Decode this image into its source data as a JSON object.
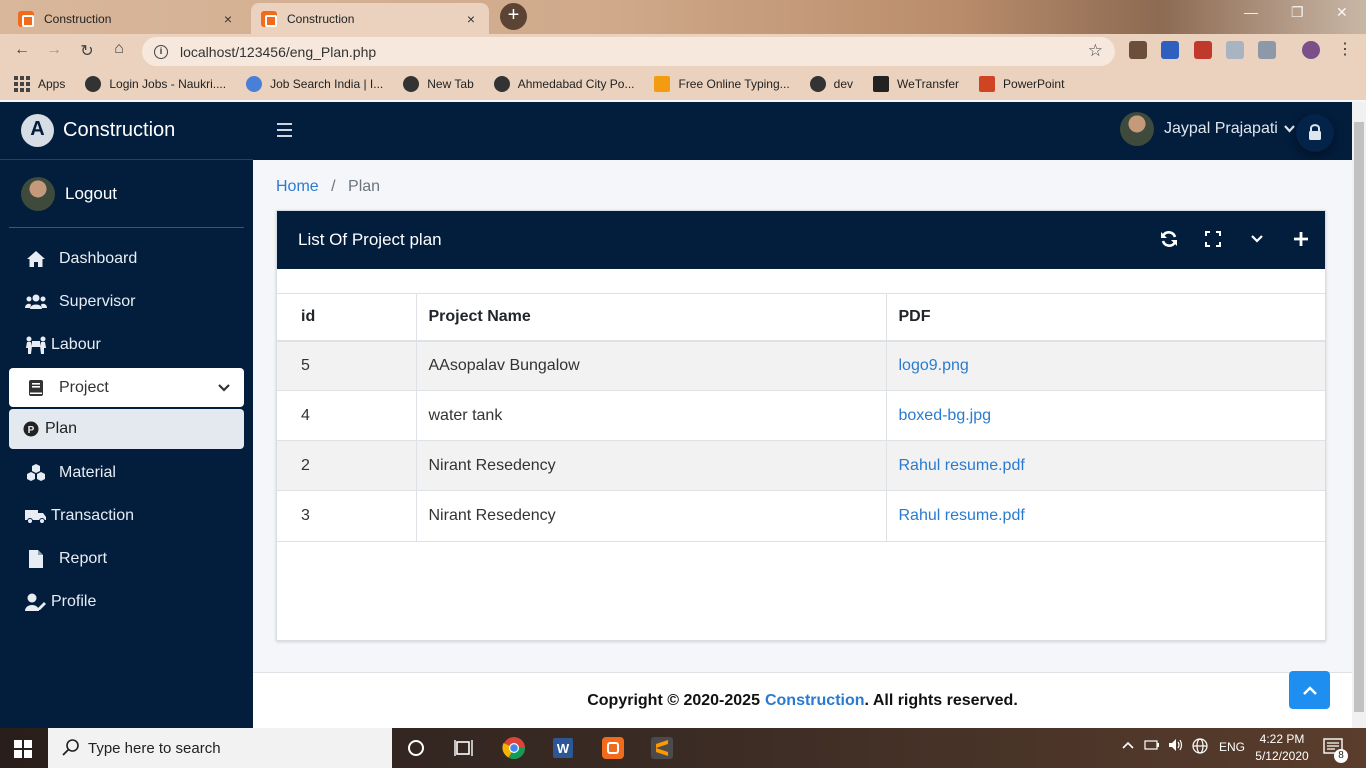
{
  "browser": {
    "tabs": [
      {
        "title": "Construction",
        "close": "×"
      },
      {
        "title": "Construction",
        "close": "×"
      }
    ],
    "new_tab": "+",
    "url": "localhost/123456/eng_Plan.php",
    "bookmarks": [
      {
        "label": "Apps"
      },
      {
        "label": "Login Jobs - Naukri...."
      },
      {
        "label": "Job Search India | I..."
      },
      {
        "label": "New Tab"
      },
      {
        "label": "Ahmedabad City Po..."
      },
      {
        "label": "Free Online Typing..."
      },
      {
        "label": "dev"
      },
      {
        "label": "WeTransfer"
      },
      {
        "label": "PowerPoint"
      }
    ]
  },
  "brand": {
    "name": "Construction"
  },
  "sidebar": {
    "logout": "Logout",
    "items": [
      {
        "label": "Dashboard",
        "icon": "home-icon"
      },
      {
        "label": "Supervisor",
        "icon": "users-icon"
      },
      {
        "label": "Labour",
        "icon": "people-carry-icon"
      },
      {
        "label": "Project",
        "icon": "book-icon"
      },
      {
        "label": "Plan",
        "icon": "plan-p-icon"
      },
      {
        "label": "Material",
        "icon": "cubes-icon"
      },
      {
        "label": "Transaction",
        "icon": "truck-icon"
      },
      {
        "label": "Report",
        "icon": "file-icon"
      },
      {
        "label": "Profile",
        "icon": "user-edit-icon"
      }
    ]
  },
  "topnav": {
    "user_name": "Jaypal Prajapati"
  },
  "breadcrumb": {
    "home": "Home",
    "separator": "/",
    "current": "Plan"
  },
  "card": {
    "title": "List Of Project plan",
    "columns": [
      "id",
      "Project Name",
      "PDF"
    ],
    "rows": [
      {
        "id": "5",
        "project_name": "AAsopalav Bungalow",
        "pdf": "logo9.png"
      },
      {
        "id": "4",
        "project_name": "water tank",
        "pdf": "boxed-bg.jpg"
      },
      {
        "id": "2",
        "project_name": "Nirant Resedency",
        "pdf": "Rahul resume.pdf"
      },
      {
        "id": "3",
        "project_name": "Nirant Resedency",
        "pdf": "Rahul resume.pdf"
      }
    ]
  },
  "footer": {
    "prefix": "Copyright © 2020-2025",
    "brand": "Construction",
    "suffix": ". All rights reserved."
  },
  "taskbar": {
    "search_placeholder": "Type here to search",
    "language": "ENG",
    "time": "4:22 PM",
    "date": "5/12/2020",
    "notifications": "8"
  },
  "colors": {
    "navy": "#031d3d",
    "link": "#2a7bd0",
    "accent": "#1e8ff0"
  }
}
